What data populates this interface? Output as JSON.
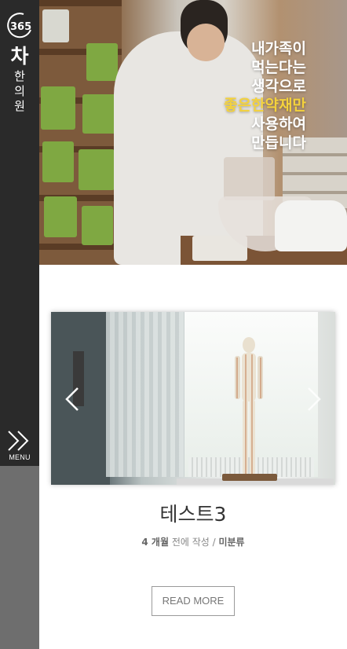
{
  "brand": {
    "logo_number": "365",
    "name_first": "차",
    "name_rest": [
      "한",
      "의",
      "원"
    ]
  },
  "menu": {
    "label": "MENU"
  },
  "hero": {
    "lines": [
      {
        "text": "내가족이",
        "color": "white"
      },
      {
        "text": "먹는다는",
        "color": "white"
      },
      {
        "text": "생각으로",
        "color": "white"
      },
      {
        "text": "좋은한약재만",
        "color": "yellow"
      },
      {
        "text": "사용하여",
        "color": "white"
      },
      {
        "text": "만듭니다",
        "color": "white"
      }
    ]
  },
  "post": {
    "title": "테스트3",
    "meta_time_bold": "4 개월",
    "meta_time_rest": " 전에 작성 / ",
    "meta_category": "미분류",
    "read_more": "READ MORE"
  },
  "colors": {
    "sidebar": "#2a2a2a",
    "sidebar_lower": "#6e6e6e",
    "hero_accent": "#f4d23c"
  }
}
